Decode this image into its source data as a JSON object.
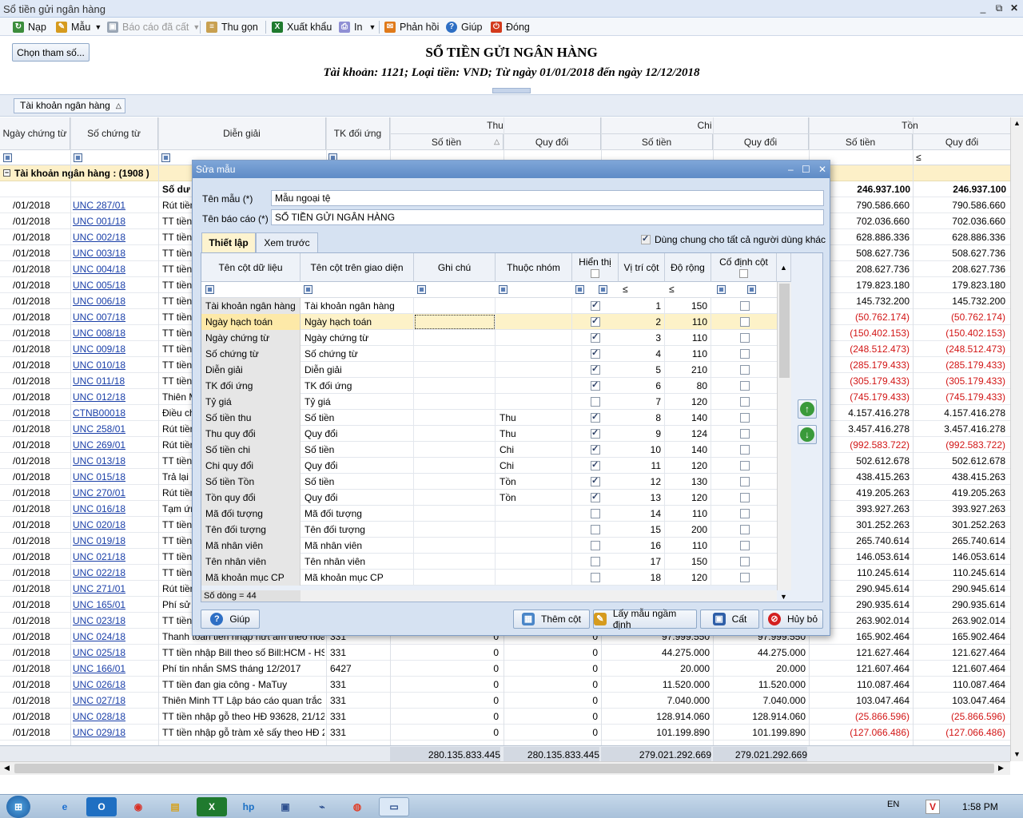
{
  "window": {
    "title": "Sổ tiền gửi ngân hàng"
  },
  "toolbar": {
    "nap": "Nạp",
    "mau": "Mẫu",
    "bao_cao_da_cat": "Báo cáo đã cất",
    "thu_gon": "Thu gọn",
    "xuat_khau": "Xuất khẩu",
    "in": "In",
    "phan_hoi": "Phản hồi",
    "giup": "Giúp",
    "dong": "Đóng"
  },
  "params_button": "Chọn tham số...",
  "report": {
    "title": "SỔ TIỀN GỬI NGÂN HÀNG",
    "subtitle": "Tài khoản: 1121; Loại tiền: VND; Từ ngày 01/01/2018 đến ngày 12/12/2018"
  },
  "groupby_chip": "Tài khoản ngân hàng",
  "columns": {
    "ngay_chung_tu": "Ngày chứng từ",
    "so_chung_tu": "Số chứng từ",
    "dien_giai": "Diễn giải",
    "tk_doi_ung": "TK đối ứng",
    "thu": "Thu",
    "chi": "Chi",
    "ton": "Tồn",
    "so_tien": "Số tiền",
    "quy_doi": "Quy đổi"
  },
  "group_row": "Tài khoản ngân hàng : (1908 )",
  "opening": {
    "label": "Số dư đ",
    "ton_so_tien": "246.937.100",
    "ton_quy_doi": "246.937.100"
  },
  "rows": [
    {
      "date": "/01/2018",
      "doc": "UNC 287/01",
      "desc": "Rút tiền",
      "ton": "790.586.660",
      "tonqd": "790.586.660",
      "neg": false
    },
    {
      "date": "/01/2018",
      "doc": "UNC 001/18",
      "desc": "TT tiền",
      "ton": "702.036.660",
      "tonqd": "702.036.660",
      "neg": false
    },
    {
      "date": "/01/2018",
      "doc": "UNC 002/18",
      "desc": "TT tiền",
      "ton": "628.886.336",
      "tonqd": "628.886.336",
      "neg": false
    },
    {
      "date": "/01/2018",
      "doc": "UNC 003/18",
      "desc": "TT tiền",
      "ton": "508.627.736",
      "tonqd": "508.627.736",
      "neg": false
    },
    {
      "date": "/01/2018",
      "doc": "UNC 004/18",
      "desc": "TT tiền",
      "ton": "208.627.736",
      "tonqd": "208.627.736",
      "neg": false
    },
    {
      "date": "/01/2018",
      "doc": "UNC 005/18",
      "desc": "TT tiền",
      "ton": "179.823.180",
      "tonqd": "179.823.180",
      "neg": false
    },
    {
      "date": "/01/2018",
      "doc": "UNC 006/18",
      "desc": "TT tiền",
      "ton": "145.732.200",
      "tonqd": "145.732.200",
      "neg": false
    },
    {
      "date": "/01/2018",
      "doc": "UNC 007/18",
      "desc": "TT tiền",
      "ton": "(50.762.174)",
      "tonqd": "(50.762.174)",
      "neg": true
    },
    {
      "date": "/01/2018",
      "doc": "UNC 008/18",
      "desc": "TT tiền",
      "ton": "(150.402.153)",
      "tonqd": "(150.402.153)",
      "neg": true
    },
    {
      "date": "/01/2018",
      "doc": "UNC 009/18",
      "desc": "TT tiền",
      "ton": "(248.512.473)",
      "tonqd": "(248.512.473)",
      "neg": true
    },
    {
      "date": "/01/2018",
      "doc": "UNC 010/18",
      "desc": "TT tiền",
      "ton": "(285.179.433)",
      "tonqd": "(285.179.433)",
      "neg": true
    },
    {
      "date": "/01/2018",
      "doc": "UNC 011/18",
      "desc": "TT tiền",
      "ton": "(305.179.433)",
      "tonqd": "(305.179.433)",
      "neg": true
    },
    {
      "date": "/01/2018",
      "doc": "UNC 012/18",
      "desc": "Thiên M",
      "ton": "(745.179.433)",
      "tonqd": "(745.179.433)",
      "neg": true
    },
    {
      "date": "/01/2018",
      "doc": "CTNB00018",
      "desc": "Điều ch",
      "ton": "4.157.416.278",
      "tonqd": "4.157.416.278",
      "neg": false
    },
    {
      "date": "/01/2018",
      "doc": "UNC 258/01",
      "desc": "Rút tiền",
      "ton": "3.457.416.278",
      "tonqd": "3.457.416.278",
      "neg": false
    },
    {
      "date": "/01/2018",
      "doc": "UNC 269/01",
      "desc": "Rút tiền",
      "ton": "(992.583.722)",
      "tonqd": "(992.583.722)",
      "neg": true
    },
    {
      "date": "/01/2018",
      "doc": "UNC 013/18",
      "desc": "TT tiền",
      "ton": "502.612.678",
      "tonqd": "502.612.678",
      "neg": false
    },
    {
      "date": "/01/2018",
      "doc": "UNC 015/18",
      "desc": "Trả lại",
      "ton": "438.415.263",
      "tonqd": "438.415.263",
      "neg": false
    },
    {
      "date": "/01/2018",
      "doc": "UNC 270/01",
      "desc": "Rút tiền",
      "ton": "419.205.263",
      "tonqd": "419.205.263",
      "neg": false
    },
    {
      "date": "/01/2018",
      "doc": "UNC 016/18",
      "desc": "Tạm ứn",
      "ton": "393.927.263",
      "tonqd": "393.927.263",
      "neg": false
    },
    {
      "date": "/01/2018",
      "doc": "UNC 020/18",
      "desc": "TT tiền",
      "ton": "301.252.263",
      "tonqd": "301.252.263",
      "neg": false
    },
    {
      "date": "/01/2018",
      "doc": "UNC 019/18",
      "desc": "TT tiền",
      "ton": "265.740.614",
      "tonqd": "265.740.614",
      "neg": false
    },
    {
      "date": "/01/2018",
      "doc": "UNC 021/18",
      "desc": "TT tiền",
      "ton": "146.053.614",
      "tonqd": "146.053.614",
      "neg": false
    },
    {
      "date": "/01/2018",
      "doc": "UNC 022/18",
      "desc": "TT tiền",
      "ton": "110.245.614",
      "tonqd": "110.245.614",
      "neg": false
    },
    {
      "date": "/01/2018",
      "doc": "UNC 271/01",
      "desc": "Rút tiền",
      "ton": "290.945.614",
      "tonqd": "290.945.614",
      "neg": false
    },
    {
      "date": "/01/2018",
      "doc": "UNC 165/01",
      "desc": "Phí sử c",
      "ton": "290.935.614",
      "tonqd": "290.935.614",
      "neg": false
    },
    {
      "date": "/01/2018",
      "doc": "UNC 023/18",
      "desc": "TT tiền",
      "ton": "263.902.014",
      "tonqd": "263.902.014",
      "neg": false
    },
    {
      "date": "/01/2018",
      "doc": "UNC 024/18",
      "desc": "Thanh toán tiền nhập nứt âm theo hoá đ",
      "tk": "331",
      "thu": "0",
      "thuqd": "0",
      "chi": "97.999.550",
      "chiqd": "97.999.550",
      "ton": "165.902.464",
      "tonqd": "165.902.464",
      "neg": false
    },
    {
      "date": "/01/2018",
      "doc": "UNC 025/18",
      "desc": "TT tiền nhập Bill theo số Bill:HCM - HS",
      "tk": "331",
      "thu": "0",
      "thuqd": "0",
      "chi": "44.275.000",
      "chiqd": "44.275.000",
      "ton": "121.627.464",
      "tonqd": "121.627.464",
      "neg": false
    },
    {
      "date": "/01/2018",
      "doc": "UNC 166/01",
      "desc": "Phí tin nhắn SMS tháng 12/2017",
      "tk": "6427",
      "thu": "0",
      "thuqd": "0",
      "chi": "20.000",
      "chiqd": "20.000",
      "ton": "121.607.464",
      "tonqd": "121.607.464",
      "neg": false
    },
    {
      "date": "/01/2018",
      "doc": "UNC 026/18",
      "desc": "TT tiền đan gia công - MaTuy",
      "tk": "331",
      "thu": "0",
      "thuqd": "0",
      "chi": "11.520.000",
      "chiqd": "11.520.000",
      "ton": "110.087.464",
      "tonqd": "110.087.464",
      "neg": false
    },
    {
      "date": "/01/2018",
      "doc": "UNC 027/18",
      "desc": "Thiên Minh TT Lập báo cáo quan trắc m",
      "tk": "331",
      "thu": "0",
      "thuqd": "0",
      "chi": "7.040.000",
      "chiqd": "7.040.000",
      "ton": "103.047.464",
      "tonqd": "103.047.464",
      "neg": false
    },
    {
      "date": "/01/2018",
      "doc": "UNC 028/18",
      "desc": "TT tiền nhập gỗ  theo HĐ 93628, 21/12",
      "tk": "331",
      "thu": "0",
      "thuqd": "0",
      "chi": "128.914.060",
      "chiqd": "128.914.060",
      "ton": "(25.866.596)",
      "tonqd": "(25.866.596)",
      "neg": true
    },
    {
      "date": "/01/2018",
      "doc": "UNC 029/18",
      "desc": "TT tiền nhập gỗ tràm xẻ sấy theo HĐ 26",
      "tk": "331",
      "thu": "0",
      "thuqd": "0",
      "chi": "101.199.890",
      "chiqd": "101.199.890",
      "ton": "(127.066.486)",
      "tonqd": "(127.066.486)",
      "neg": true
    }
  ],
  "totals": {
    "thu": "280.135.833.445",
    "thuqd": "280.135.833.445",
    "chi": "279.021.292.669",
    "chiqd": "279.021.292.669"
  },
  "dialog": {
    "title": "Sửa mẫu",
    "ten_mau_label": "Tên mẫu (*)",
    "ten_mau_value": "Mẫu ngoại tệ",
    "ten_bao_cao_label": "Tên báo cáo (*)",
    "ten_bao_cao_value": "SỔ TIỀN GỬI NGÂN HÀNG",
    "tab_setup": "Thiết lập",
    "tab_preview": "Xem trước",
    "shared_label": "Dùng chung cho tất cả người dùng khác",
    "grid_headers": {
      "col_data": "Tên cột dữ liệu",
      "col_ui": "Tên cột trên giao diện",
      "note": "Ghi chú",
      "group": "Thuộc nhóm",
      "visible": "Hiển thị",
      "pos": "Vị trí cột",
      "width": "Độ rộng",
      "fixed": "Cố định cột"
    },
    "filter_le": "≤",
    "rows": [
      {
        "data": "Tài khoản ngân hàng",
        "ui": "Tài khoản ngân hàng",
        "group": "",
        "vis": true,
        "pos": "1",
        "w": "150"
      },
      {
        "data": "Ngày hạch toán",
        "ui": "Ngày hạch toán",
        "group": "",
        "vis": true,
        "pos": "2",
        "w": "110"
      },
      {
        "data": "Ngày chứng từ",
        "ui": "Ngày chứng từ",
        "group": "",
        "vis": true,
        "pos": "3",
        "w": "110"
      },
      {
        "data": "Số chứng từ",
        "ui": "Số chứng từ",
        "group": "",
        "vis": true,
        "pos": "4",
        "w": "110"
      },
      {
        "data": "Diễn giải",
        "ui": "Diễn giải",
        "group": "",
        "vis": true,
        "pos": "5",
        "w": "210"
      },
      {
        "data": "TK đối ứng",
        "ui": "TK đối ứng",
        "group": "",
        "vis": true,
        "pos": "6",
        "w": "80"
      },
      {
        "data": "Tỷ giá",
        "ui": "Tỷ giá",
        "group": "",
        "vis": false,
        "pos": "7",
        "w": "120"
      },
      {
        "data": "Số tiền thu",
        "ui": "Số tiền",
        "group": "Thu",
        "vis": true,
        "pos": "8",
        "w": "140"
      },
      {
        "data": "Thu quy đổi",
        "ui": "Quy đổi",
        "group": "Thu",
        "vis": true,
        "pos": "9",
        "w": "124"
      },
      {
        "data": "Số tiền chi",
        "ui": "Số tiền",
        "group": "Chi",
        "vis": true,
        "pos": "10",
        "w": "140"
      },
      {
        "data": "Chi quy đổi",
        "ui": "Quy đổi",
        "group": "Chi",
        "vis": true,
        "pos": "11",
        "w": "120"
      },
      {
        "data": "Số tiền Tồn",
        "ui": "Số tiền",
        "group": "Tồn",
        "vis": true,
        "pos": "12",
        "w": "130"
      },
      {
        "data": "Tồn quy đổi",
        "ui": "Quy đổi",
        "group": "Tồn",
        "vis": true,
        "pos": "13",
        "w": "120"
      },
      {
        "data": "Mã đối tượng",
        "ui": "Mã đối tượng",
        "group": "",
        "vis": false,
        "pos": "14",
        "w": "110"
      },
      {
        "data": "Tên đối tượng",
        "ui": "Tên đối tượng",
        "group": "",
        "vis": false,
        "pos": "15",
        "w": "200"
      },
      {
        "data": "Mã nhân viên",
        "ui": "Mã nhân viên",
        "group": "",
        "vis": false,
        "pos": "16",
        "w": "110"
      },
      {
        "data": "Tên nhân viên",
        "ui": "Tên nhân viên",
        "group": "",
        "vis": false,
        "pos": "17",
        "w": "150"
      },
      {
        "data": "Mã khoản mục CP",
        "ui": "Mã khoản mục CP",
        "group": "",
        "vis": false,
        "pos": "18",
        "w": "120"
      }
    ],
    "row_count": "Số dòng = 44",
    "btn_help": "Giúp",
    "btn_add_col": "Thêm cột",
    "btn_default": "Lấy mẫu ngầm định",
    "btn_save": "Cất",
    "btn_cancel": "Hủy bỏ"
  },
  "taskbar": {
    "lang": "EN",
    "time": "1:58 PM"
  }
}
